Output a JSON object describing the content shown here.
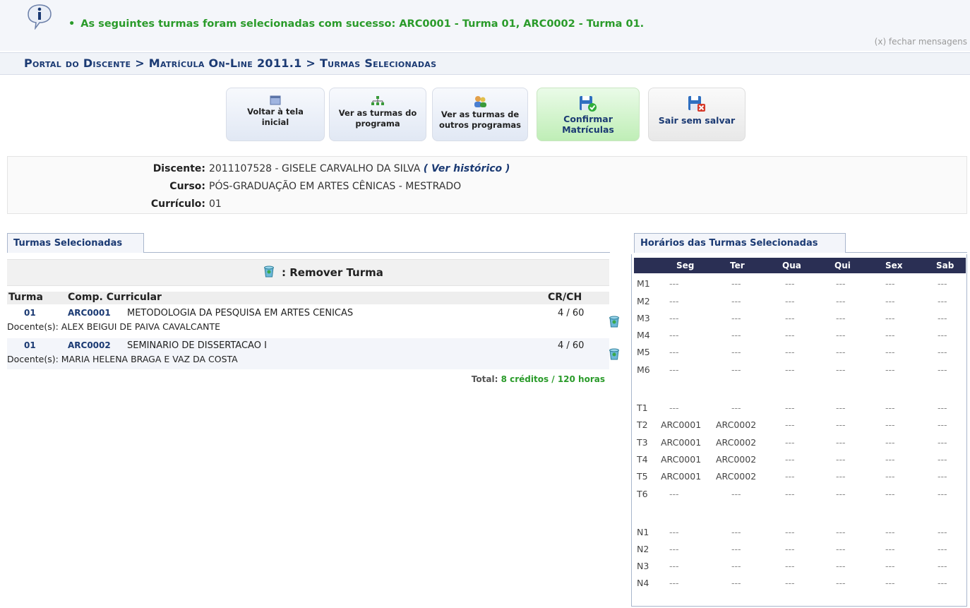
{
  "message": {
    "text": "As seguintes turmas foram selecionadas com sucesso: ARC0001 - Turma 01, ARC0002 - Turma 01.",
    "close": "(x) fechar mensagens"
  },
  "breadcrumb": "Portal do Discente > Matrícula On-Line 2011.1 > Turmas Selecionadas",
  "toolbar": [
    {
      "line1": "Voltar à tela",
      "line2": "inicial"
    },
    {
      "line1": "Ver as turmas do",
      "line2": "programa"
    },
    {
      "line1": "Ver as turmas de",
      "line2": "outros programas"
    },
    {
      "line1": "Confirmar",
      "line2": "Matrículas"
    },
    {
      "line1": "Sair sem salvar",
      "line2": ""
    }
  ],
  "student": {
    "discente_label": "Discente:",
    "discente_value": "2011107528 - GISELE CARVALHO DA SILVA",
    "historico_link": "( Ver histórico )",
    "curso_label": "Curso:",
    "curso_value": "PÓS-GRADUAÇÃO EM ARTES CÊNICAS - MESTRADO",
    "curriculo_label": "Currículo:",
    "curriculo_value": "01"
  },
  "tabs": {
    "left": "Turmas Selecionadas",
    "right": "Horários das Turmas Selecionadas"
  },
  "selected": {
    "remove_label": ": Remover Turma",
    "headers": {
      "turma": "Turma",
      "comp": "Comp. Curricular",
      "crch": "CR/CH"
    },
    "rows": [
      {
        "turma": "01",
        "code": "ARC0001",
        "name": "METODOLOGIA DA PESQUISA EM ARTES CENICAS",
        "crch": "4 / 60",
        "docente": "Docente(s): ALEX BEIGUI DE PAIVA CAVALCANTE"
      },
      {
        "turma": "01",
        "code": "ARC0002",
        "name": "SEMINARIO DE DISSERTACAO I",
        "crch": "4 / 60",
        "docente": "Docente(s): MARIA HELENA BRAGA E VAZ DA COSTA"
      }
    ],
    "total_label": "Total:",
    "total_value": "8 créditos / 120 horas"
  },
  "schedule": {
    "days": [
      "Seg",
      "Ter",
      "Qua",
      "Qui",
      "Sex",
      "Sab"
    ],
    "rows": [
      {
        "slot": "M1",
        "cells": [
          "---",
          "---",
          "---",
          "---",
          "---",
          "---"
        ]
      },
      {
        "slot": "M2",
        "cells": [
          "---",
          "---",
          "---",
          "---",
          "---",
          "---"
        ]
      },
      {
        "slot": "M3",
        "cells": [
          "---",
          "---",
          "---",
          "---",
          "---",
          "---"
        ]
      },
      {
        "slot": "M4",
        "cells": [
          "---",
          "---",
          "---",
          "---",
          "---",
          "---"
        ]
      },
      {
        "slot": "M5",
        "cells": [
          "---",
          "---",
          "---",
          "---",
          "---",
          "---"
        ]
      },
      {
        "slot": "M6",
        "cells": [
          "---",
          "---",
          "---",
          "---",
          "---",
          "---"
        ]
      },
      {
        "slot": "T1",
        "cells": [
          "---",
          "---",
          "---",
          "---",
          "---",
          "---"
        ]
      },
      {
        "slot": "T2",
        "cells": [
          "ARC0001",
          "ARC0002",
          "---",
          "---",
          "---",
          "---"
        ]
      },
      {
        "slot": "T3",
        "cells": [
          "ARC0001",
          "ARC0002",
          "---",
          "---",
          "---",
          "---"
        ]
      },
      {
        "slot": "T4",
        "cells": [
          "ARC0001",
          "ARC0002",
          "---",
          "---",
          "---",
          "---"
        ]
      },
      {
        "slot": "T5",
        "cells": [
          "ARC0001",
          "ARC0002",
          "---",
          "---",
          "---",
          "---"
        ]
      },
      {
        "slot": "T6",
        "cells": [
          "---",
          "---",
          "---",
          "---",
          "---",
          "---"
        ]
      },
      {
        "slot": "N1",
        "cells": [
          "---",
          "---",
          "---",
          "---",
          "---",
          "---"
        ]
      },
      {
        "slot": "N2",
        "cells": [
          "---",
          "---",
          "---",
          "---",
          "---",
          "---"
        ]
      },
      {
        "slot": "N3",
        "cells": [
          "---",
          "---",
          "---",
          "---",
          "---",
          "---"
        ]
      },
      {
        "slot": "N4",
        "cells": [
          "---",
          "---",
          "---",
          "---",
          "---",
          "---"
        ]
      }
    ]
  },
  "colors": {
    "link": "#1b3a73",
    "success": "#2a9b2a",
    "schedule_header": "#2a2f54"
  }
}
